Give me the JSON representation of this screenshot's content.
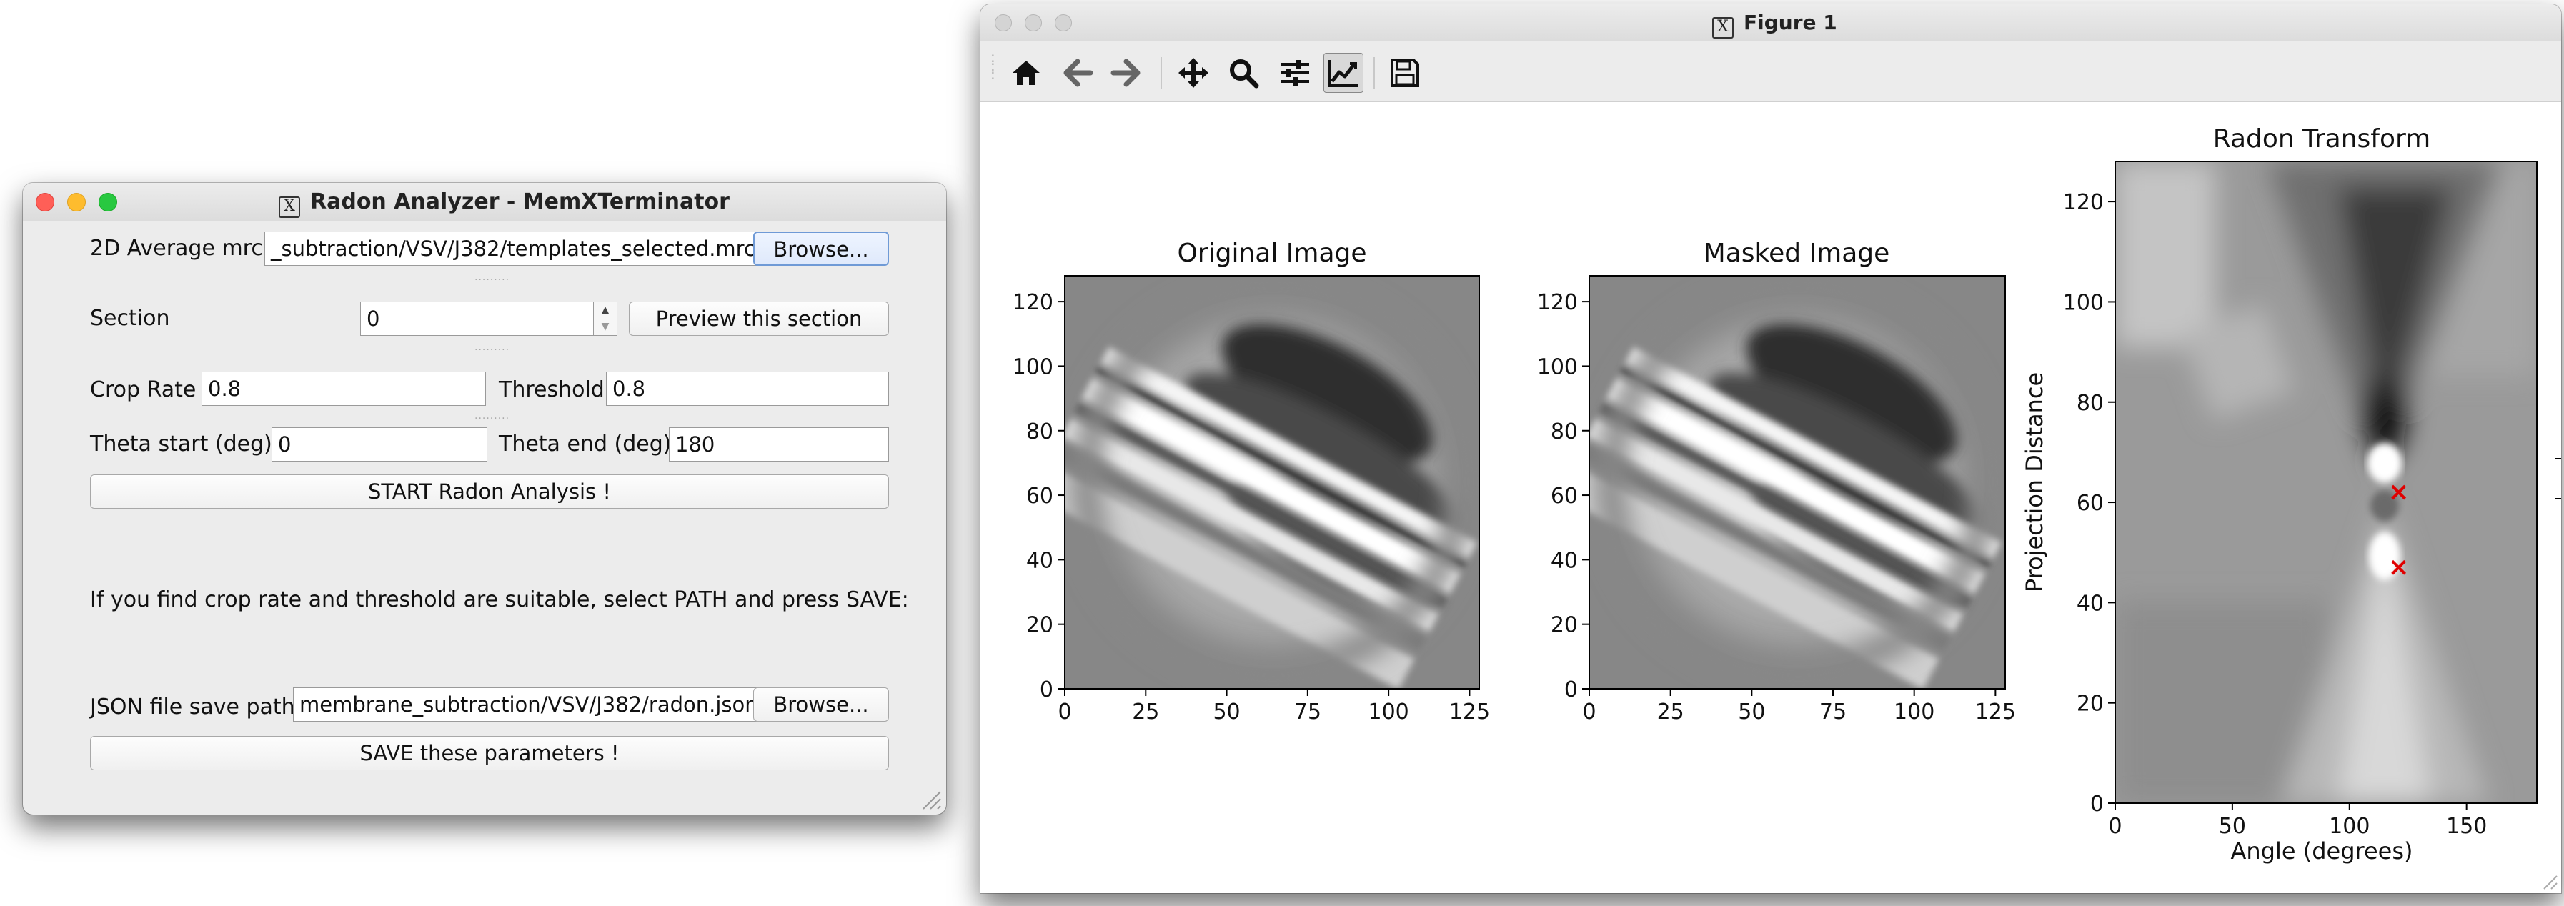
{
  "radon_window": {
    "title": "Radon Analyzer - MemXTerminator",
    "mrc_label": "2D Average mrc",
    "mrc_path": "_subtraction/VSV/J382/templates_selected.mrc",
    "browse_label": "Browse...",
    "section_label": "Section",
    "section_value": "0",
    "preview_label": "Preview this section",
    "crop_rate_label": "Crop Rate",
    "crop_rate_value": "0.8",
    "threshold_label": "Threshold",
    "threshold_value": "0.8",
    "theta_start_label": "Theta start (deg)",
    "theta_start_value": "0",
    "theta_end_label": "Theta end (deg)",
    "theta_end_value": "180",
    "start_label": "START Radon Analysis !",
    "info_text": "If you find crop rate and threshold are suitable, select PATH and press SAVE:",
    "json_label": "JSON file save path",
    "json_path": "membrane_subtraction/VSV/J382/radon.json",
    "browse2_label": "Browse...",
    "save_label": "SAVE these parameters !"
  },
  "figure_window": {
    "title": "Figure 1",
    "toolbar": [
      {
        "name": "home-icon"
      },
      {
        "name": "back-arrow-icon"
      },
      {
        "name": "forward-arrow-icon"
      },
      {
        "name": "pan-move-icon"
      },
      {
        "name": "zoom-magnifier-icon"
      },
      {
        "name": "configure-subplots-icon"
      },
      {
        "name": "edit-axis-icon",
        "active": true
      },
      {
        "name": "save-floppy-icon"
      }
    ]
  },
  "chart_data": [
    {
      "type": "image",
      "title": "Original Image",
      "xlim": [
        0,
        128
      ],
      "ylim": [
        0,
        128
      ],
      "xticks": [
        "0",
        "25",
        "50",
        "75",
        "100",
        "125"
      ],
      "yticks": [
        "0",
        "20",
        "40",
        "60",
        "80",
        "100",
        "120"
      ]
    },
    {
      "type": "image",
      "title": "Masked Image",
      "xlim": [
        0,
        128
      ],
      "ylim": [
        0,
        128
      ],
      "xticks": [
        "0",
        "25",
        "50",
        "75",
        "100",
        "125"
      ],
      "yticks": [
        "0",
        "20",
        "40",
        "60",
        "80",
        "100",
        "120"
      ]
    },
    {
      "type": "heatmap",
      "title": "Radon Transform",
      "xlabel": "Angle (degrees)",
      "ylabel": "Projection Distance",
      "xlim": [
        0,
        180
      ],
      "ylim": [
        0,
        128
      ],
      "xticks": [
        "0",
        "50",
        "100",
        "150"
      ],
      "yticks": [
        "0",
        "20",
        "40",
        "60",
        "80",
        "100",
        "120"
      ],
      "markers": [
        {
          "symbol": "x",
          "color": "#e00000",
          "x": 121,
          "y": 62
        },
        {
          "symbol": "x",
          "color": "#e00000",
          "x": 121,
          "y": 47
        }
      ]
    }
  ]
}
